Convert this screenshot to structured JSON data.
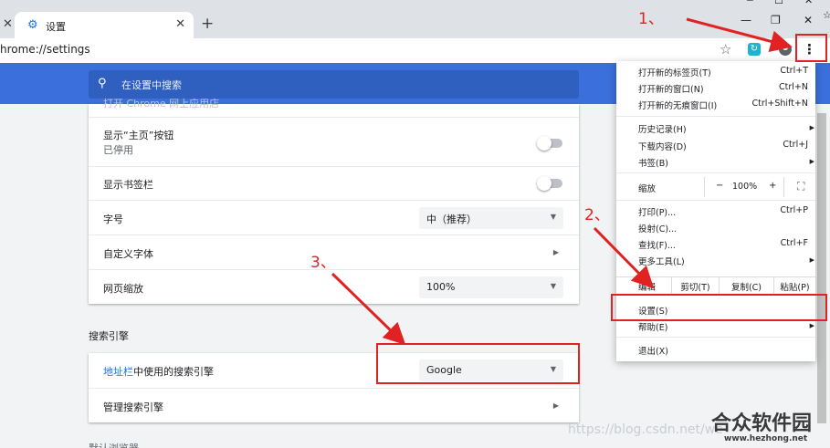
{
  "browser": {
    "tab_title": "设置",
    "new_tab_glyph": "+",
    "close_glyph": "✕",
    "url": "hrome://settings",
    "window_buttons": {
      "minimize": "—",
      "restore": "❐",
      "close": "✕"
    },
    "top_cut": {
      "minimize": "─",
      "restore": "☐",
      "close": "✕",
      "star": "☆"
    }
  },
  "header": {
    "search_placeholder": "在设置中搜索"
  },
  "appearance": {
    "hidden_top_text": "打开 Chrome 网上应用店",
    "rows": [
      {
        "label": "显示“主页”按钮",
        "sub": "已停用"
      },
      {
        "label": "显示书签栏"
      },
      {
        "label": "字号",
        "value": "中（推荐）"
      },
      {
        "label": "自定义字体"
      },
      {
        "label": "网页缩放",
        "value": "100%"
      }
    ]
  },
  "search_engine": {
    "section_title": "搜索引擎",
    "address_bar_link": "地址栏",
    "address_bar_rest": "中使用的搜索引擎",
    "engine_value": "Google",
    "manage_label": "管理搜索引擎",
    "next_section_cut": "默认浏览器"
  },
  "menu": {
    "items": [
      {
        "label": "打开新的标签页(T)",
        "shortcut": "Ctrl+T"
      },
      {
        "label": "打开新的窗口(N)",
        "shortcut": "Ctrl+N"
      },
      {
        "label": "打开新的无痕窗口(I)",
        "shortcut": "Ctrl+Shift+N"
      },
      {
        "label": "历史记录(H)"
      },
      {
        "label": "下载内容(D)",
        "shortcut": "Ctrl+J"
      },
      {
        "label": "书签(B)"
      },
      {
        "label": "打印(P)...",
        "shortcut": "Ctrl+P"
      },
      {
        "label": "投射(C)..."
      },
      {
        "label": "查找(F)...",
        "shortcut": "Ctrl+F"
      },
      {
        "label": "更多工具(L)"
      },
      {
        "label": "设置(S)"
      },
      {
        "label": "帮助(E)"
      },
      {
        "label": "退出(X)"
      }
    ],
    "zoom": {
      "label": "缩放",
      "minus": "−",
      "value": "100%",
      "plus": "+",
      "fullscreen": "⛶"
    },
    "edit": {
      "label": "编辑",
      "cut": "剪切(T)",
      "copy": "复制(C)",
      "paste": "粘贴(P)"
    }
  },
  "annotations": {
    "step1": "1、",
    "step2": "2、",
    "step3": "3、"
  },
  "watermark": {
    "url": "https://blog.csdn.net/we",
    "logo": "合众软件园",
    "site": "www.hezhong.net"
  },
  "colors": {
    "accent": "#3b6fdc",
    "annotation": "#e02222",
    "link": "#1a73e8"
  }
}
